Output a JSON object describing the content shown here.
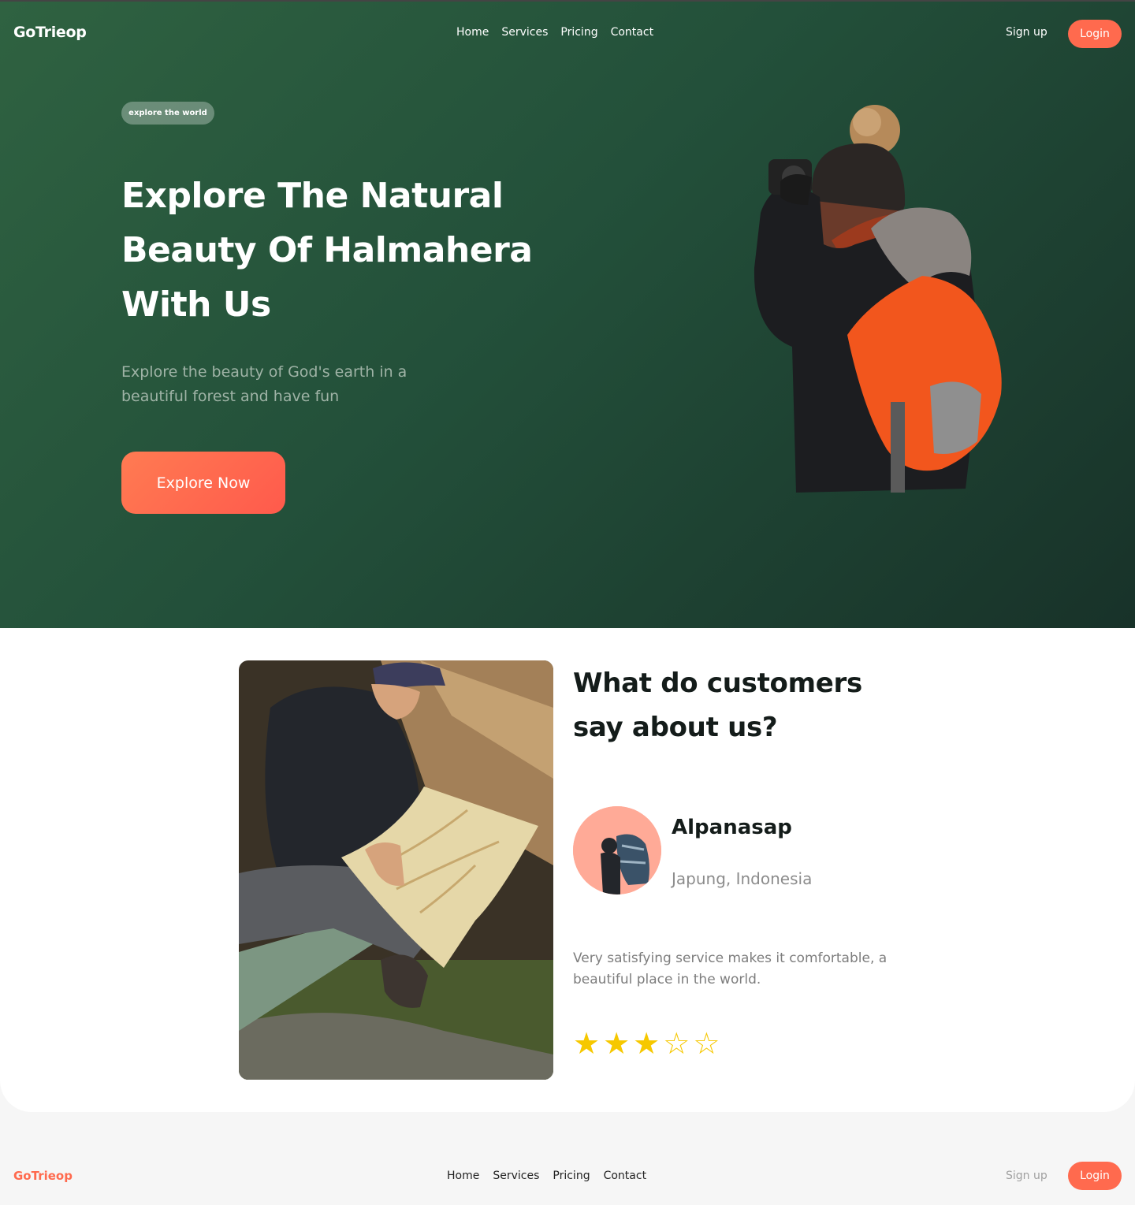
{
  "brand": {
    "name": "GoTrieop",
    "accent": "#ff6a4e",
    "hero_green": "#23503a"
  },
  "nav": {
    "links": [
      "Home",
      "Services",
      "Pricing",
      "Contact"
    ],
    "signup": "Sign up",
    "login": "Login"
  },
  "hero": {
    "badge": "explore the world",
    "title": "Explore The Natural Beauty Of Halmahera With Us",
    "subtitle": "Explore the beauty of God's earth in a beautiful forest and have fun",
    "cta": "Explore Now",
    "image_icon": "hiker-photo"
  },
  "testimonial": {
    "title": "What do customers say about us?",
    "image_icon": "map-reading-photo",
    "name": "Alpanasap",
    "location": "Japung, Indonesia",
    "quote": "Very satisfying service makes it comfortable, a beautiful place in the world.",
    "rating": 3,
    "max_rating": 5,
    "star_color": "#f6c800"
  },
  "footer": {
    "brand": "GoTrieop",
    "links": [
      "Home",
      "Services",
      "Pricing",
      "Contact"
    ],
    "signup": "Sign up",
    "login": "Login"
  }
}
